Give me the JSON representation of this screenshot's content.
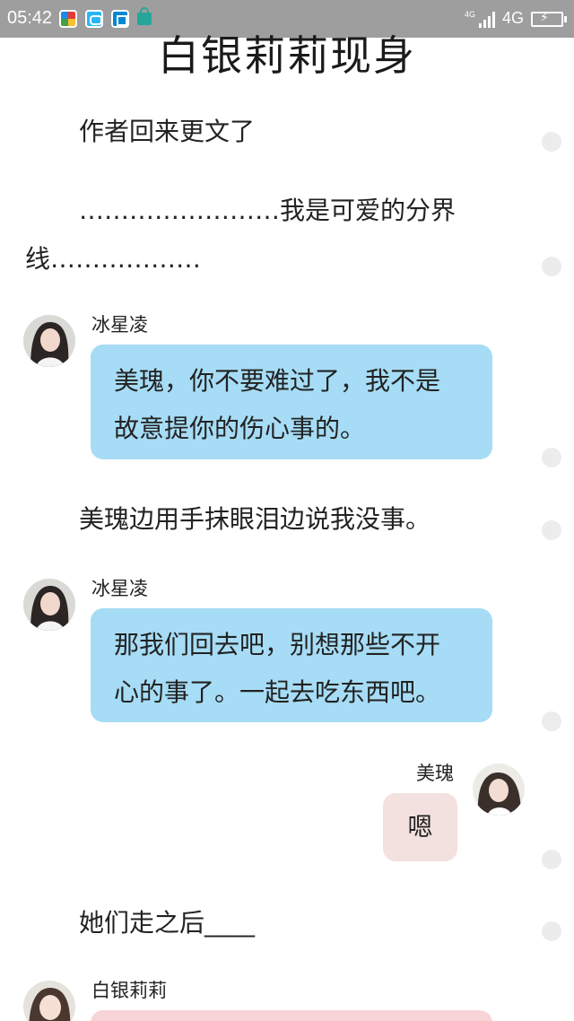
{
  "status_bar": {
    "time": "05:42",
    "network_small": "4G",
    "network": "4G"
  },
  "title": "白银莉莉现身",
  "narration": {
    "line1": "作者回来更文了",
    "divider_a": "……………………我是可爱的分界",
    "divider_b": "线………………",
    "line2": "美瑰边用手抹眼泪边说我没事。",
    "line3": "她们走之后____"
  },
  "messages": [
    {
      "speaker": "冰星凌",
      "text_lines": [
        "美瑰，你不要难过了，我不是",
        "故意提你的伤心事的。"
      ]
    },
    {
      "speaker": "冰星凌",
      "text_lines": [
        "那我们回去吧，别想那些不开",
        "心的事了。一起去吃东西吧。"
      ]
    },
    {
      "speaker": "美瑰",
      "text_lines": [
        "嗯"
      ]
    },
    {
      "speaker": "白银莉莉",
      "text_lines": []
    }
  ],
  "colors": {
    "bubble_blue": "#a6dcf5",
    "bubble_pink": "#f3e1df",
    "bubble_rose": "#f8d4d8",
    "status_bar": "#9e9e9e"
  }
}
